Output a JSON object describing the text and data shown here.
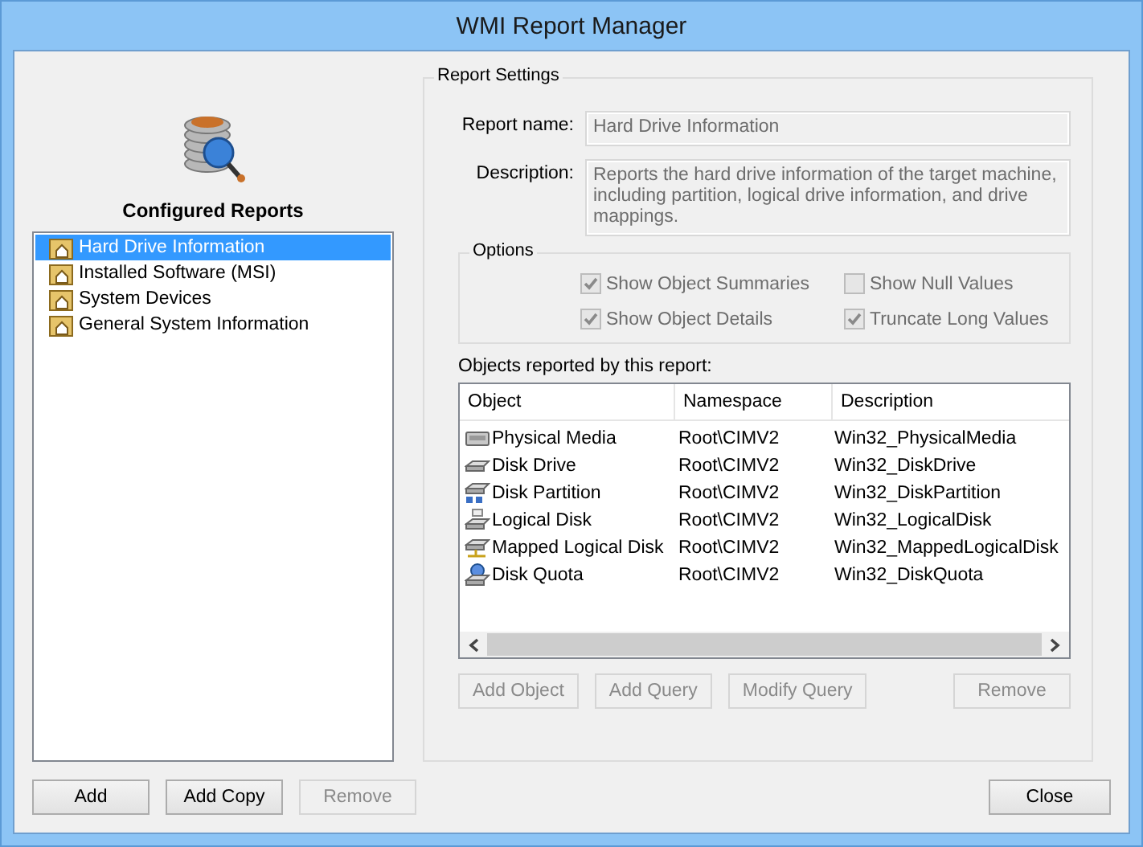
{
  "window": {
    "title": "WMI Report Manager"
  },
  "configured_reports": {
    "heading": "Configured Reports",
    "items": [
      {
        "label": "Hard Drive Information",
        "selected": true
      },
      {
        "label": "Installed Software (MSI)",
        "selected": false
      },
      {
        "label": "System Devices",
        "selected": false
      },
      {
        "label": "General System Information",
        "selected": false
      }
    ],
    "buttons": [
      {
        "label": "Add",
        "disabled": false
      },
      {
        "label": "Add Copy",
        "disabled": false
      },
      {
        "label": "Remove",
        "disabled": true
      }
    ]
  },
  "report_settings": {
    "title": "Report Settings",
    "report_name": {
      "label": "Report name:",
      "value": "Hard Drive Information"
    },
    "description": {
      "label": "Description:",
      "value": "Reports the hard drive information of the target machine, including partition, logical drive information, and drive mappings."
    },
    "options": {
      "title": "Options",
      "items": [
        {
          "label": "Show Object Summaries",
          "checked": true,
          "disabled": true
        },
        {
          "label": "Show Null Values",
          "checked": false,
          "disabled": true
        },
        {
          "label": "Show Object Details",
          "checked": true,
          "disabled": true
        },
        {
          "label": "Truncate Long Values",
          "checked": true,
          "disabled": true
        }
      ]
    },
    "objects_label": "Objects reported by this report:",
    "table": {
      "columns": [
        "Object",
        "Namespace",
        "Description"
      ],
      "rows": [
        {
          "kind": "media",
          "cells": [
            "Physical Media",
            "Root\\CIMV2",
            "Win32_PhysicalMedia"
          ]
        },
        {
          "kind": "drive",
          "cells": [
            "Disk Drive",
            "Root\\CIMV2",
            "Win32_DiskDrive"
          ]
        },
        {
          "kind": "partition",
          "cells": [
            "Disk Partition",
            "Root\\CIMV2",
            "Win32_DiskPartition"
          ]
        },
        {
          "kind": "logical",
          "cells": [
            "Logical Disk",
            "Root\\CIMV2",
            "Win32_LogicalDisk"
          ]
        },
        {
          "kind": "mapped",
          "cells": [
            "Mapped Logical Disk",
            "Root\\CIMV2",
            "Win32_MappedLogicalDisk"
          ]
        },
        {
          "kind": "quota",
          "cells": [
            "Disk Quota",
            "Root\\CIMV2",
            "Win32_DiskQuota"
          ]
        }
      ]
    },
    "buttons": [
      {
        "label": "Add Object",
        "disabled": true
      },
      {
        "label": "Add Query",
        "disabled": true
      },
      {
        "label": "Modify Query",
        "disabled": true
      },
      {
        "label": "Remove",
        "disabled": true
      }
    ]
  },
  "close_button": {
    "label": "Close",
    "disabled": false
  }
}
